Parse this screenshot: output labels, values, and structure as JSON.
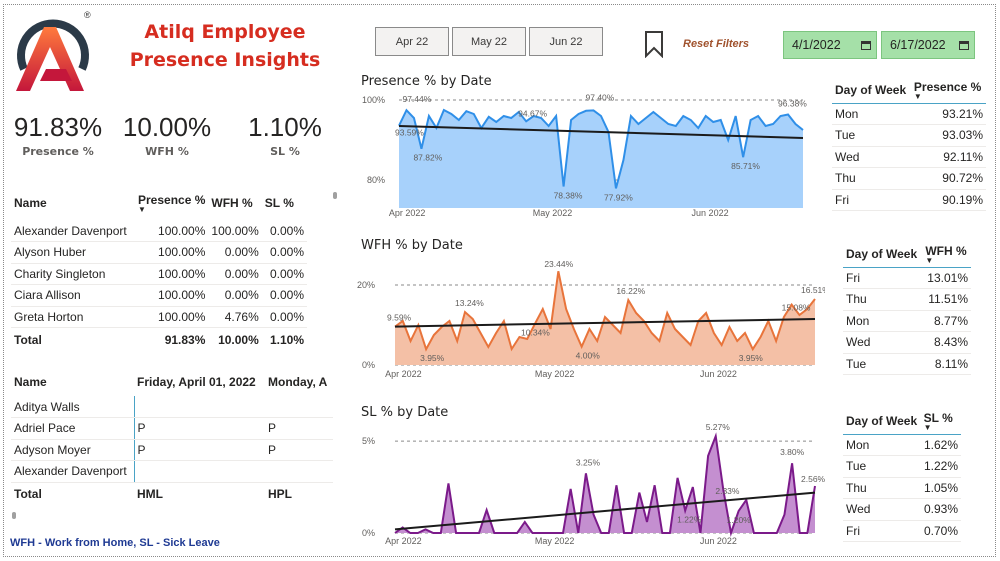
{
  "header": {
    "title_line1": "Atilq Employee",
    "title_line2": "Presence Insights",
    "logo_mark": "®"
  },
  "kpis": [
    {
      "value": "91.83%",
      "label": "Presence %"
    },
    {
      "value": "10.00%",
      "label": "WFH %"
    },
    {
      "value": "1.10%",
      "label": "SL %"
    }
  ],
  "month_buttons": [
    "Apr 22",
    "May 22",
    "Jun 22"
  ],
  "reset_filters": "Reset Filters",
  "date_range": {
    "start": "4/1/2022",
    "end": "6/17/2022"
  },
  "employee_table": {
    "headers": [
      "Name",
      "Presence %",
      "WFH %",
      "SL %"
    ],
    "rows": [
      [
        "Alexander Davenport",
        "100.00%",
        "100.00%",
        "0.00%"
      ],
      [
        "Alyson Huber",
        "100.00%",
        "0.00%",
        "0.00%"
      ],
      [
        "Charity Singleton",
        "100.00%",
        "0.00%",
        "0.00%"
      ],
      [
        "Ciara Allison",
        "100.00%",
        "0.00%",
        "0.00%"
      ],
      [
        "Greta Horton",
        "100.00%",
        "4.76%",
        "0.00%"
      ]
    ],
    "total": [
      "Total",
      "91.83%",
      "10.00%",
      "1.10%"
    ]
  },
  "attendance_table": {
    "headers": [
      "Name",
      "Friday, April 01, 2022",
      "Monday, A"
    ],
    "rows": [
      [
        "Aditya Walls",
        "",
        ""
      ],
      [
        "Adriel Pace",
        "P",
        "P"
      ],
      [
        "Adyson Moyer",
        "P",
        "P"
      ],
      [
        "Alexander Davenport",
        "",
        ""
      ]
    ],
    "total": [
      "Total",
      "HML",
      "HPL"
    ]
  },
  "legend_text": "WFH - Work from Home, SL - Sick Leave",
  "presence_dow": {
    "headers": [
      "Day of Week",
      "Presence %"
    ],
    "rows": [
      [
        "Mon",
        "93.21%"
      ],
      [
        "Tue",
        "93.03%"
      ],
      [
        "Wed",
        "92.11%"
      ],
      [
        "Thu",
        "90.72%"
      ],
      [
        "Fri",
        "90.19%"
      ]
    ]
  },
  "wfh_dow": {
    "headers": [
      "Day of Week",
      "WFH %"
    ],
    "rows": [
      [
        "Fri",
        "13.01%"
      ],
      [
        "Thu",
        "11.51%"
      ],
      [
        "Mon",
        "8.77%"
      ],
      [
        "Wed",
        "8.43%"
      ],
      [
        "Tue",
        "8.11%"
      ]
    ]
  },
  "sl_dow": {
    "headers": [
      "Day of Week",
      "SL %"
    ],
    "rows": [
      [
        "Mon",
        "1.62%"
      ],
      [
        "Tue",
        "1.22%"
      ],
      [
        "Thu",
        "1.05%"
      ],
      [
        "Wed",
        "0.93%"
      ],
      [
        "Fri",
        "0.70%"
      ]
    ]
  },
  "colors": {
    "title": "#d62d20",
    "presence_line": "#2f8fe8",
    "presence_fill": "#a7d1fb",
    "wfh_line": "#e8743b",
    "wfh_fill": "#f4c0a6",
    "sl_line": "#7b1a8a",
    "sl_fill": "#c48fd0",
    "date_slicer": "#a5e0a8"
  },
  "chart_data": [
    {
      "type": "area",
      "title": "Presence % by Date",
      "x_ticks": [
        "Apr 2022",
        "May 2022",
        "Jun 2022"
      ],
      "y_ticks": [
        "100%",
        "80%"
      ],
      "ylim": [
        73,
        100
      ],
      "trend": [
        93.5,
        90.5
      ],
      "values": [
        93.59,
        97.44,
        95.5,
        87.82,
        96,
        93,
        97.5,
        96.5,
        95,
        97.2,
        96.5,
        93,
        95.8,
        94.5,
        96,
        95.5,
        97,
        94.67,
        96,
        95.5,
        93.5,
        96,
        78.38,
        95,
        96.5,
        97.3,
        97.4,
        96,
        92,
        77.92,
        85,
        96,
        94,
        95.5,
        97,
        95.5,
        94,
        93.5,
        96,
        95,
        93,
        96,
        94.5,
        95,
        90,
        96,
        85.71,
        95,
        96,
        93.5,
        94,
        96,
        96.38,
        94,
        92.5
      ],
      "data_labels": [
        "93.59%",
        "97.44%",
        "87.82%",
        "94.67%",
        "97.40%",
        "78.38%",
        "77.92%",
        "85.71%",
        "96.38%"
      ],
      "grid": "dashed at 100% and 80%"
    },
    {
      "type": "area",
      "title": "WFH % by Date",
      "x_ticks": [
        "Apr 2022",
        "May 2022",
        "Jun 2022"
      ],
      "y_ticks": [
        "20%",
        "0%"
      ],
      "ylim": [
        0,
        25
      ],
      "trend": [
        9.6,
        11.5
      ],
      "values": [
        9.59,
        11,
        6,
        10,
        3.95,
        7.5,
        9.5,
        11,
        6,
        13.24,
        11.5,
        8,
        4.5,
        8,
        11,
        4,
        7,
        6.5,
        10.34,
        14,
        9,
        23.44,
        14,
        9,
        4.6,
        9,
        6,
        12,
        10,
        8,
        16.22,
        13,
        11,
        8,
        6,
        13,
        9,
        7,
        5,
        11,
        13,
        8,
        5,
        9.5,
        6,
        8,
        3.95,
        7,
        11,
        6,
        12,
        15.08,
        12.5,
        14,
        16.51
      ],
      "data_labels": [
        "9.59%",
        "3.95%",
        "13.24%",
        "10.34%",
        "23.44%",
        "4.00%",
        "16.22%",
        "3.95%",
        "15.08%",
        "16.51%"
      ],
      "grid": "dashed at 20% and 0%"
    },
    {
      "type": "area",
      "title": "SL % by Date",
      "x_ticks": [
        "Apr 2022",
        "May 2022",
        "Jun 2022"
      ],
      "y_ticks": [
        "5%",
        "0%"
      ],
      "ylim": [
        0,
        5.5
      ],
      "trend": [
        0.2,
        2.2
      ],
      "values": [
        0,
        0.3,
        0,
        0,
        0.2,
        0,
        0,
        2.7,
        0,
        0,
        0,
        0,
        1.25,
        0,
        0,
        0,
        0,
        0.6,
        0,
        0,
        0,
        0,
        0,
        2.4,
        0,
        3.25,
        1.0,
        0,
        0,
        2.6,
        0,
        0,
        2.2,
        0.6,
        2.6,
        0,
        0,
        3.0,
        1.22,
        2.5,
        0,
        4.2,
        5.27,
        2.33,
        0,
        1.2,
        1.8,
        0,
        0,
        0,
        0,
        1.0,
        3.8,
        0,
        0,
        2.56
      ],
      "data_labels": [
        "3.25%",
        "1.22%",
        "5.27%",
        "2.33%",
        "1.20%",
        "3.80%",
        "2.56%"
      ],
      "grid": "dashed at 5% and 0%"
    }
  ]
}
